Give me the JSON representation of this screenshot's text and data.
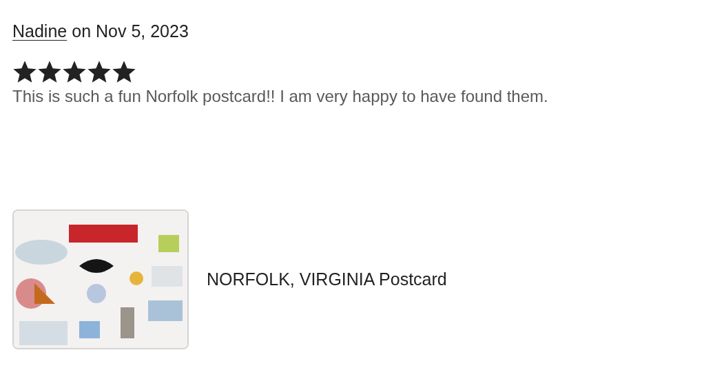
{
  "review": {
    "author": "Nadine",
    "date_text": "on Nov 5, 2023",
    "stars": 5,
    "text": "This is such a fun Norfolk postcard!! I am very happy to have found them."
  },
  "item": {
    "title": "NORFOLK, VIRGINIA Postcard"
  }
}
